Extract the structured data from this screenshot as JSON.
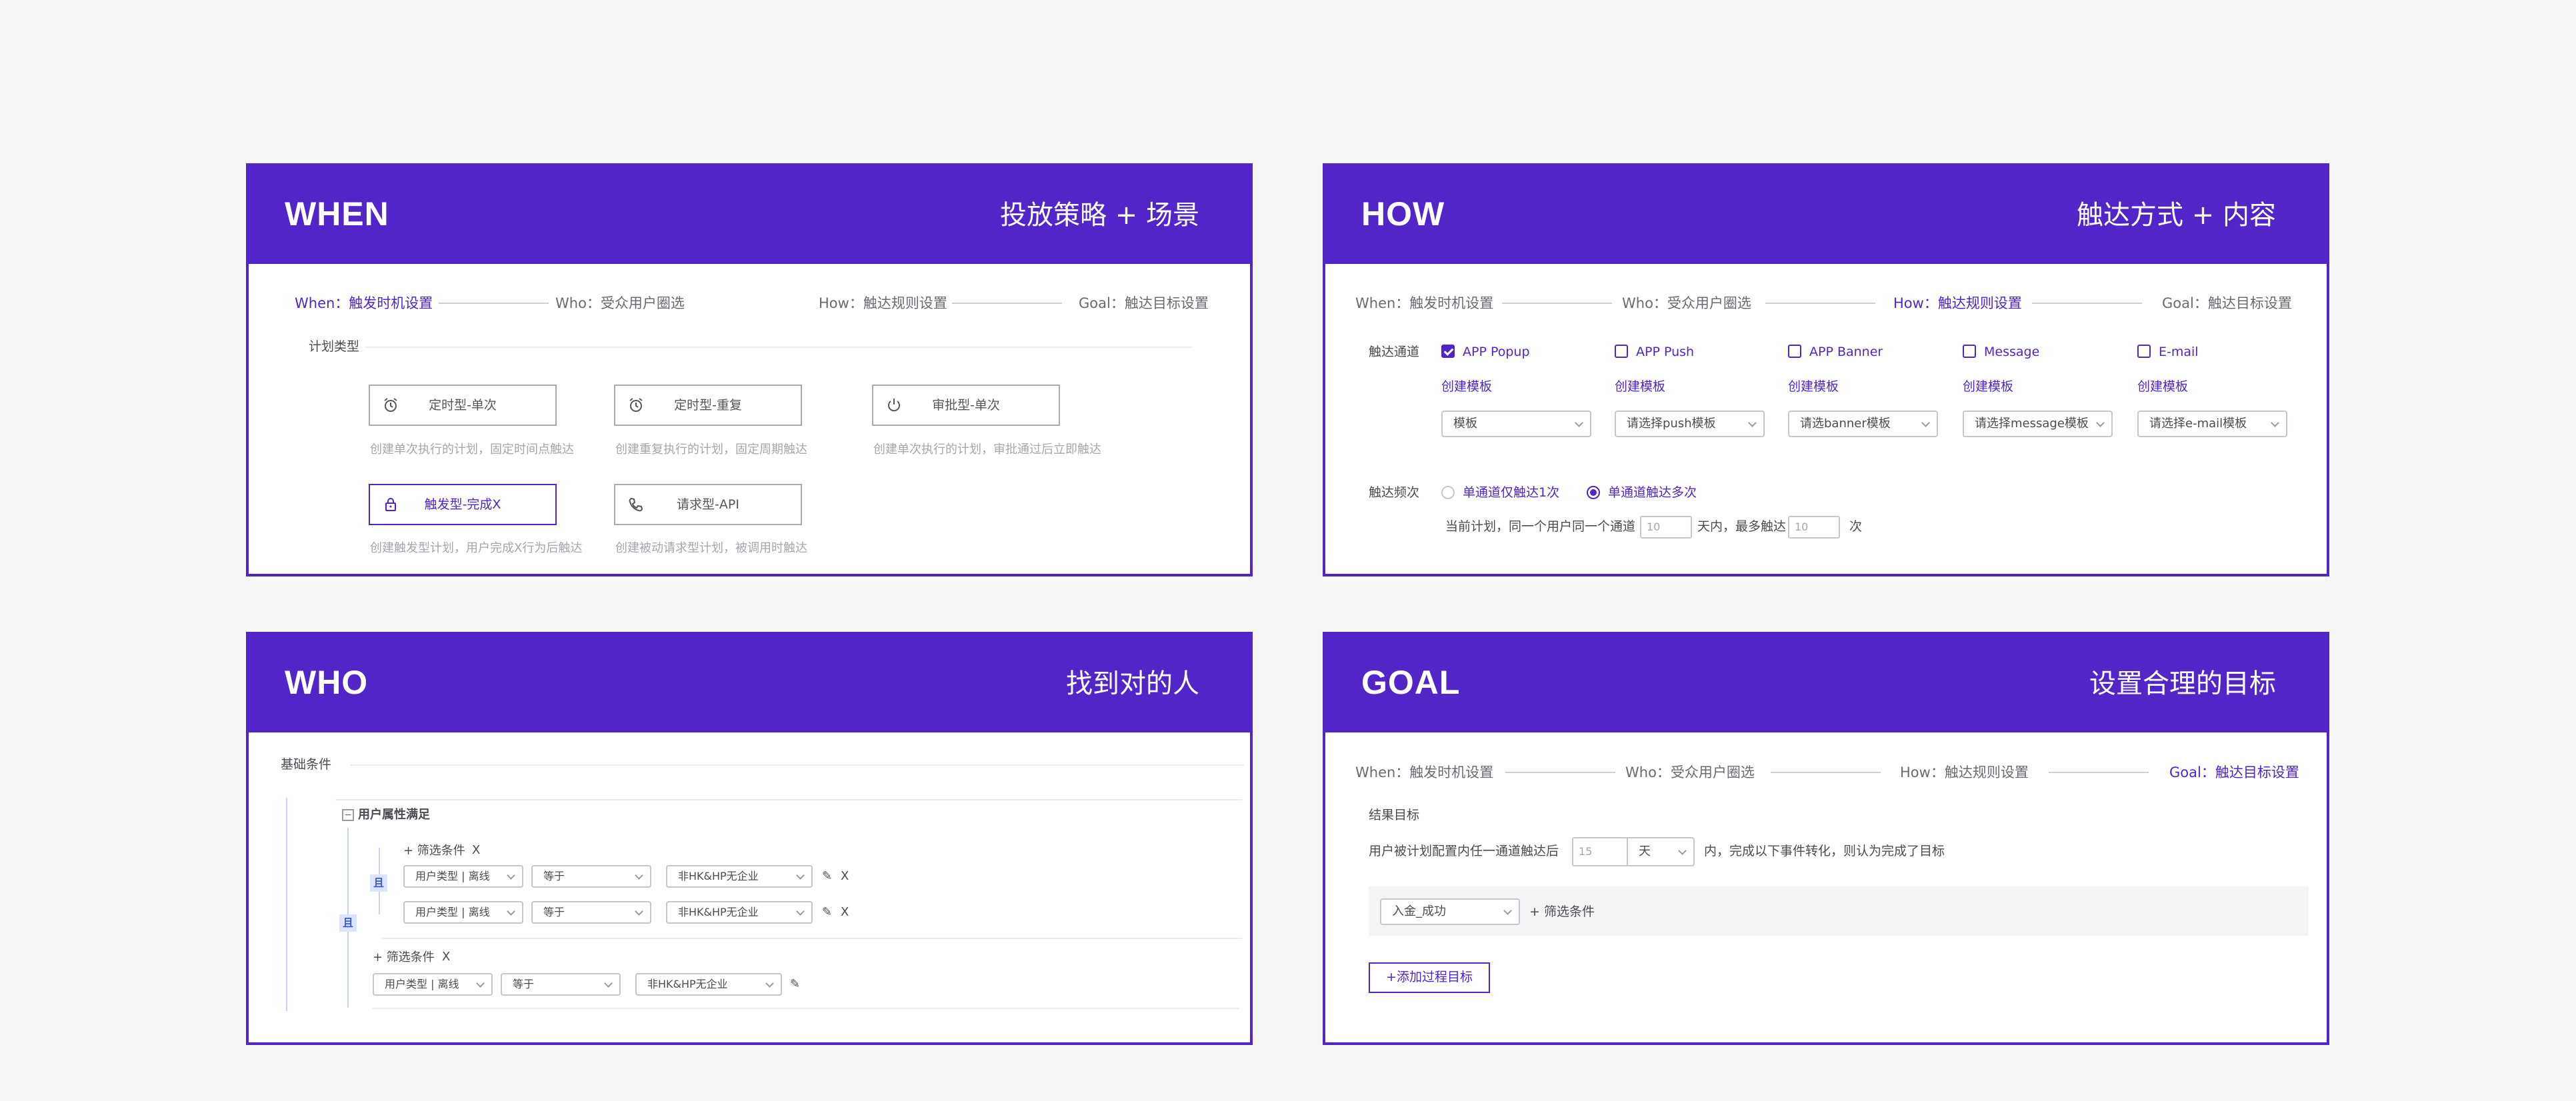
{
  "when": {
    "title": "WHEN",
    "subtitle": "投放策略 + 场景",
    "steps": [
      "When：触发时机设置",
      "Who：受众用户圈选",
      "How：触达规则设置",
      "Goal：触达目标设置"
    ],
    "active_step": 0,
    "section_label": "计划类型",
    "cards": [
      {
        "label": "定时型-单次",
        "hint": "创建单次执行的计划，固定时间点触达",
        "icon": "alarm-clock-icon"
      },
      {
        "label": "定时型-重复",
        "hint": "创建重复执行的计划，固定周期触达",
        "icon": "alarm-clock-icon"
      },
      {
        "label": "审批型-单次",
        "hint": "创建单次执行的计划，审批通过后立即触达",
        "icon": "power-icon"
      },
      {
        "label": "触发型-完成X",
        "hint": "创建触发型计划，用户完成X行为后触达",
        "icon": "lock-icon",
        "selected": true
      },
      {
        "label": "请求型-API",
        "hint": "创建被动请求型计划，被调用时触达",
        "icon": "phone-icon"
      }
    ]
  },
  "how": {
    "title": "HOW",
    "subtitle": "触达方式 + 内容",
    "steps": [
      "When：触发时机设置",
      "Who：受众用户圈选",
      "How：触达规则设置",
      "Goal：触达目标设置"
    ],
    "active_step": 2,
    "channel_label": "触达通道",
    "channels": [
      {
        "name": "APP Popup",
        "checked": true,
        "link": "创建模板",
        "select": "模板"
      },
      {
        "name": "APP Push",
        "checked": false,
        "link": "创建模板",
        "select": "请选择push模板"
      },
      {
        "name": "APP Banner",
        "checked": false,
        "link": "创建模板",
        "select": "请选banner模板"
      },
      {
        "name": "Message",
        "checked": false,
        "link": "创建模板",
        "select": "请选择message模板"
      },
      {
        "name": "E-mail",
        "checked": false,
        "link": "创建模板",
        "select": "请选择e-mail模板"
      }
    ],
    "freq_label": "触达频次",
    "freq_options": [
      {
        "label": "单通道仅触达1次",
        "selected": false
      },
      {
        "label": "单通道触达多次",
        "selected": true
      }
    ],
    "freq_text_1": "当前计划，同一个用户同一个通道",
    "freq_days": "10",
    "freq_text_2": "天内，最多触达",
    "freq_times": "10",
    "freq_text_3": "次"
  },
  "who": {
    "title": "WHO",
    "subtitle": "找到对的人",
    "section_label": "基础条件",
    "group_label": "用户属性满足",
    "and_label": "且",
    "add_filter": "+ 筛选条件",
    "close": "X",
    "rows": [
      {
        "field": "用户类型 | 离线",
        "op": "等于",
        "value": "非HK&HP无企业"
      },
      {
        "field": "用户类型 | 离线",
        "op": "等于",
        "value": "非HK&HP无企业"
      },
      {
        "field": "用户类型 | 离线",
        "op": "等于",
        "value": "非HK&HP无企业"
      }
    ]
  },
  "goal": {
    "title": "GOAL",
    "subtitle": "设置合理的目标",
    "steps": [
      "When：触发时机设置",
      "Who：受众用户圈选",
      "How：触达规则设置",
      "Goal：触达目标设置"
    ],
    "active_step": 3,
    "result_label": "结果目标",
    "rule_text_1": "用户被计划配置内任一通道触达后",
    "rule_num": "15",
    "rule_unit": "天",
    "rule_text_2": "内，完成以下事件转化，则认为完成了目标",
    "event": "入金_成功",
    "add_filter": "+ 筛选条件",
    "add_goal_button": "+添加过程目标"
  },
  "colors": {
    "accent": "#5125c8",
    "background": "#f7f7f8"
  }
}
